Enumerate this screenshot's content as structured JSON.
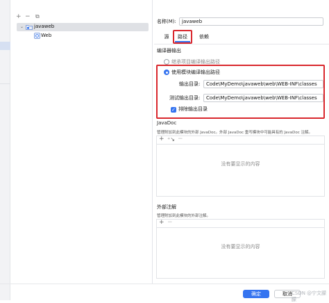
{
  "tree": {
    "toolbar": {
      "add_icon": "+",
      "remove_icon": "−",
      "copy_icon": "⧉"
    },
    "root": {
      "label": "javaweb",
      "icon": "module-folder-icon"
    },
    "child": {
      "label": "Web",
      "icon": "web-facet-icon"
    }
  },
  "form": {
    "name_label": "名称(M):",
    "name_value": "javaweb",
    "tabs": [
      "源",
      "路径",
      "依赖"
    ],
    "active_tab": "路径"
  },
  "compiler_output": {
    "section_title": "编译器输出",
    "inherit_label": "继承项目编译输出路径",
    "use_module_label": "使用模块编译输出路径",
    "output_dir_label": "输出目录:",
    "output_dir_value": "Code\\MyDemo\\javaweb\\web\\WEB-INF\\classes",
    "test_dir_label": "测试输出目录:",
    "test_dir_value": "Code\\MyDemo\\javaweb\\web\\WEB-INF\\classes",
    "exclude_label": "排除输出目录",
    "exclude_checked": true,
    "highlight_color": "#d9262c"
  },
  "javadoc": {
    "title": "JavaDoc",
    "description": "管理附加到此模块的外部 JavaDoc。外部 JavaDoc 重写模块中可能具有的 JavaDoc 注解。",
    "empty_text": "没有要显示的内容"
  },
  "annotations": {
    "title": "外部注解",
    "description": "管理附加到此模块的外部注解。",
    "empty_text": "没有要显示的内容"
  },
  "footer": {
    "ok_label": "确定",
    "cancel_label": "取消",
    "watermark": "CSDN @宁文朦朦"
  },
  "colors": {
    "accent": "#3574f0"
  }
}
